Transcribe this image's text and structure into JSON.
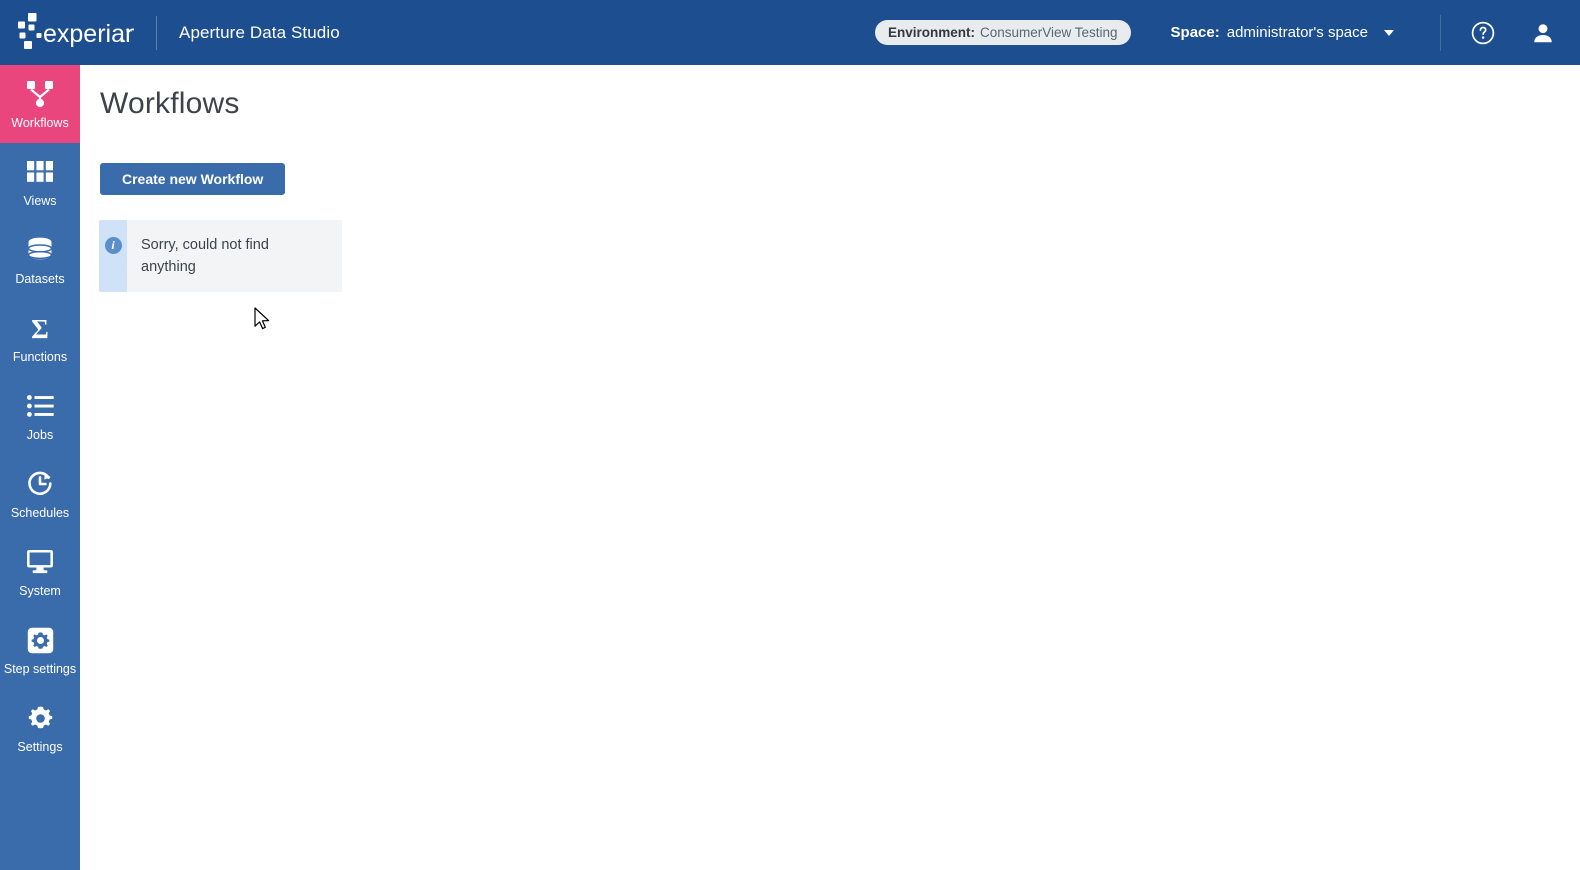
{
  "header": {
    "logo_name": "experian-logo",
    "logo_text": "experian.",
    "app_title": "Aperture Data Studio",
    "environment": {
      "label": "Environment:",
      "value": "ConsumerView Testing"
    },
    "space": {
      "label": "Space:",
      "value": "administrator's space",
      "caret_icon": "chevron-down-icon"
    },
    "help_icon": "help-circle-icon",
    "account_icon": "user-avatar-icon"
  },
  "sidebar": {
    "items": [
      {
        "label": "Workflows",
        "icon": "workflow-node-icon",
        "active": true
      },
      {
        "label": "Views",
        "icon": "grid-icon",
        "active": false
      },
      {
        "label": "Datasets",
        "icon": "database-icon",
        "active": false
      },
      {
        "label": "Functions",
        "icon": "sigma-icon",
        "active": false
      },
      {
        "label": "Jobs",
        "icon": "list-icon",
        "active": false
      },
      {
        "label": "Schedules",
        "icon": "clock-arrow-icon",
        "active": false
      },
      {
        "label": "System",
        "icon": "monitor-icon",
        "active": false
      },
      {
        "label": "Step settings",
        "icon": "gear-square-icon",
        "active": false
      },
      {
        "label": "Settings",
        "icon": "gear-icon",
        "active": false
      }
    ]
  },
  "main": {
    "page_title": "Workflows",
    "create_button": "Create new Workflow",
    "info_message": "Sorry, could not find anything",
    "info_icon": "info-circle-icon"
  },
  "colors": {
    "header_blue": "#1d4f90",
    "sidebar_blue": "#3a6cab",
    "active_pink": "#e8467c",
    "button_blue": "#3a6cab",
    "info_strip_blue": "#cfe2f7",
    "info_body_gray": "#f2f4f6",
    "text_dark": "#3c4349"
  }
}
